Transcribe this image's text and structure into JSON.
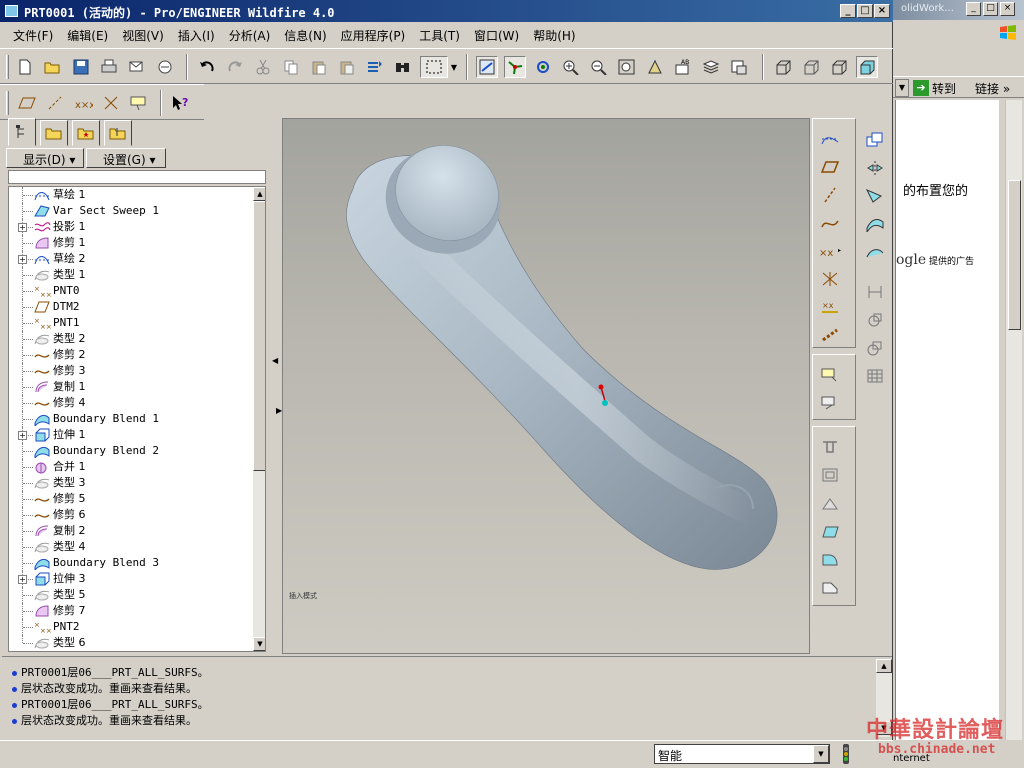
{
  "window": {
    "title": "PRT0001 (活动的) - Pro/ENGINEER Wildfire 4.0",
    "controls": [
      "_",
      "□",
      "×"
    ]
  },
  "menu": [
    "文件(F)",
    "编辑(E)",
    "视图(V)",
    "插入(I)",
    "分析(A)",
    "信息(N)",
    "应用程序(P)",
    "工具(T)",
    "窗口(W)",
    "帮助(H)"
  ],
  "toolbar_icons": {
    "row1": [
      "new-file-icon",
      "open-file-icon",
      "save-icon",
      "print-icon",
      "send-mail-icon",
      "send-mail-alt-icon",
      "undo-icon",
      "redo-icon",
      "cut-icon",
      "copy-icon",
      "paste-icon",
      "paste-special-icon",
      "regenerate-icon",
      "find-icon",
      "select-box-icon",
      "select-dropdown-icon",
      "datum-display-icon",
      "spin-center-icon",
      "orient-mode-icon",
      "zoom-in-icon",
      "zoom-out-icon",
      "refit-icon",
      "reorient-icon",
      "saved-views-icon",
      "layers-icon",
      "view-manager-icon",
      "wireframe-icon",
      "hidden-line-icon",
      "no-hidden-icon",
      "shading-icon"
    ],
    "row2": [
      "datum-plane-display-icon",
      "datum-axis-display-icon",
      "datum-point-display-icon",
      "csys-display-icon",
      "annotation-display-icon",
      "context-help-icon"
    ]
  },
  "model_tree": {
    "tabs": [
      "model-tree-tab-icon",
      "folder-browser-tab-icon",
      "favorites-tab-icon",
      "connections-tab-icon"
    ],
    "show_label": "显示(D)",
    "settings_label": "设置(G)",
    "items": [
      {
        "label": "草绘 1",
        "icon": "sketch-icon",
        "expand": false
      },
      {
        "label": "Var Sect Sweep 1",
        "icon": "sweep-icon",
        "expand": false
      },
      {
        "label": "投影 1",
        "icon": "projection-icon",
        "expand": true
      },
      {
        "label": "修剪 1",
        "icon": "trim-surface-icon",
        "expand": false
      },
      {
        "label": "草绘 2",
        "icon": "sketch-icon",
        "expand": true
      },
      {
        "label": "类型 1",
        "icon": "style-icon",
        "expand": false
      },
      {
        "label": "PNT0",
        "icon": "datum-point-icon",
        "expand": false
      },
      {
        "label": "DTM2",
        "icon": "datum-plane-icon",
        "expand": false
      },
      {
        "label": "PNT1",
        "icon": "datum-point-icon",
        "expand": false
      },
      {
        "label": "类型 2",
        "icon": "style-icon",
        "expand": false
      },
      {
        "label": "修剪 2",
        "icon": "trim-curve-icon",
        "expand": false
      },
      {
        "label": "修剪 3",
        "icon": "trim-curve-icon",
        "expand": false
      },
      {
        "label": "复制 1",
        "icon": "copy-surface-icon",
        "expand": false
      },
      {
        "label": "修剪 4",
        "icon": "trim-curve-icon",
        "expand": false
      },
      {
        "label": "Boundary Blend 1",
        "icon": "boundary-blend-icon",
        "expand": false
      },
      {
        "label": "拉伸 1",
        "icon": "extrude-icon",
        "expand": true
      },
      {
        "label": "Boundary Blend 2",
        "icon": "boundary-blend-icon",
        "expand": false
      },
      {
        "label": "合并 1",
        "icon": "merge-icon",
        "expand": false
      },
      {
        "label": "类型 3",
        "icon": "style-icon",
        "expand": false
      },
      {
        "label": "修剪 5",
        "icon": "trim-curve-icon",
        "expand": false
      },
      {
        "label": "修剪 6",
        "icon": "trim-curve-icon",
        "expand": false
      },
      {
        "label": "复制 2",
        "icon": "copy-surface-icon",
        "expand": false
      },
      {
        "label": "类型 4",
        "icon": "style-icon",
        "expand": false
      },
      {
        "label": "Boundary Blend 3",
        "icon": "boundary-blend-icon",
        "expand": false
      },
      {
        "label": "拉伸 3",
        "icon": "extrude-icon",
        "expand": true
      },
      {
        "label": "类型 5",
        "icon": "style-icon",
        "expand": false
      },
      {
        "label": "修剪 7",
        "icon": "trim-surface-icon",
        "expand": false
      },
      {
        "label": "PNT2",
        "icon": "datum-point-icon",
        "expand": false
      },
      {
        "label": "类型 6",
        "icon": "style-icon",
        "expand": false
      }
    ]
  },
  "viewport": {
    "label": "插入模式"
  },
  "messages": [
    "PRT0001层06___PRT_ALL_SURFS。",
    "层状态改变成功。重画来查看结果。",
    "PRT0001层06___PRT_ALL_SURFS。",
    "层状态改变成功。重画来查看结果。"
  ],
  "status": {
    "filter_value": "智能"
  },
  "background_window": {
    "title": "olidWork...",
    "go_label": "转到",
    "links_label": "链接",
    "content_text": "的布置您的",
    "ad_text": "提供的广告",
    "ad_logo": "ogle",
    "status_text": "nternet"
  },
  "watermark": {
    "main": "中華設計論壇",
    "url": "bbs.chinade.net"
  },
  "colors": {
    "title_active_start": "#0a246a",
    "title_active_end": "#3a6ea5",
    "model_surface": "#a9b8c4",
    "message_bullet": "#1a3ccf",
    "watermark_red": "#d62828"
  }
}
